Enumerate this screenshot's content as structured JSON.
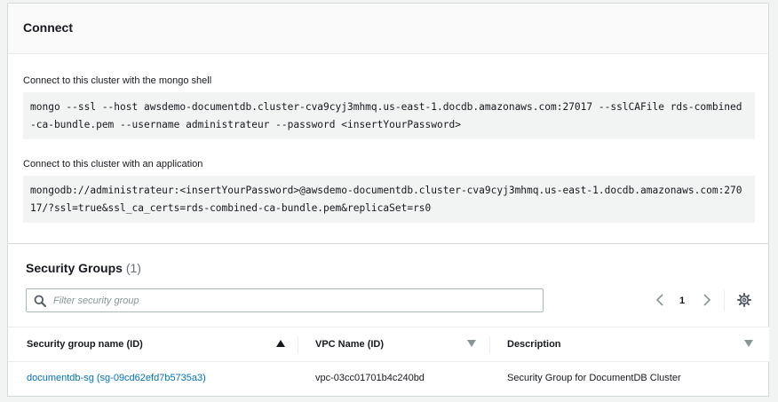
{
  "connect": {
    "title": "Connect",
    "mongo_shell_label": "Connect to this cluster with the mongo shell",
    "mongo_shell_command": "mongo --ssl --host awsdemo-documentdb.cluster-cva9cyj3mhmq.us-east-1.docdb.amazonaws.com:27017 --sslCAFile rds-combined-ca-bundle.pem --username administrateur --password <insertYourPassword>",
    "application_label": "Connect to this cluster with an application",
    "application_uri": "mongodb://administrateur:<insertYourPassword>@awsdemo-documentdb.cluster-cva9cyj3mhmq.us-east-1.docdb.amazonaws.com:27017/?ssl=true&ssl_ca_certs=rds-combined-ca-bundle.pem&replicaSet=rs0"
  },
  "security_groups": {
    "title": "Security Groups",
    "count": "(1)",
    "filter_placeholder": "Filter security group",
    "pagination": {
      "current_page": "1"
    },
    "columns": [
      {
        "label": "Security group name (ID)",
        "sort": "ascending"
      },
      {
        "label": "VPC Name (ID)",
        "sort": "none"
      },
      {
        "label": "Description",
        "sort": "none"
      }
    ],
    "rows": [
      {
        "name": "documentdb-sg (sg-09cd62efd7b5735a3)",
        "vpc": "vpc-03cc01701b4c240bd",
        "description": "Security Group for DocumentDB Cluster"
      }
    ]
  },
  "icons": {
    "search": "search-icon",
    "prev": "chevron-left-icon",
    "next": "chevron-right-icon",
    "settings": "gear-icon",
    "sort_asc": "caret-up-icon",
    "sort_none": "caret-down-icon"
  },
  "colors": {
    "link": "#0073bb",
    "code_background": "#f2f3f3",
    "border": "#d5dbdb"
  }
}
